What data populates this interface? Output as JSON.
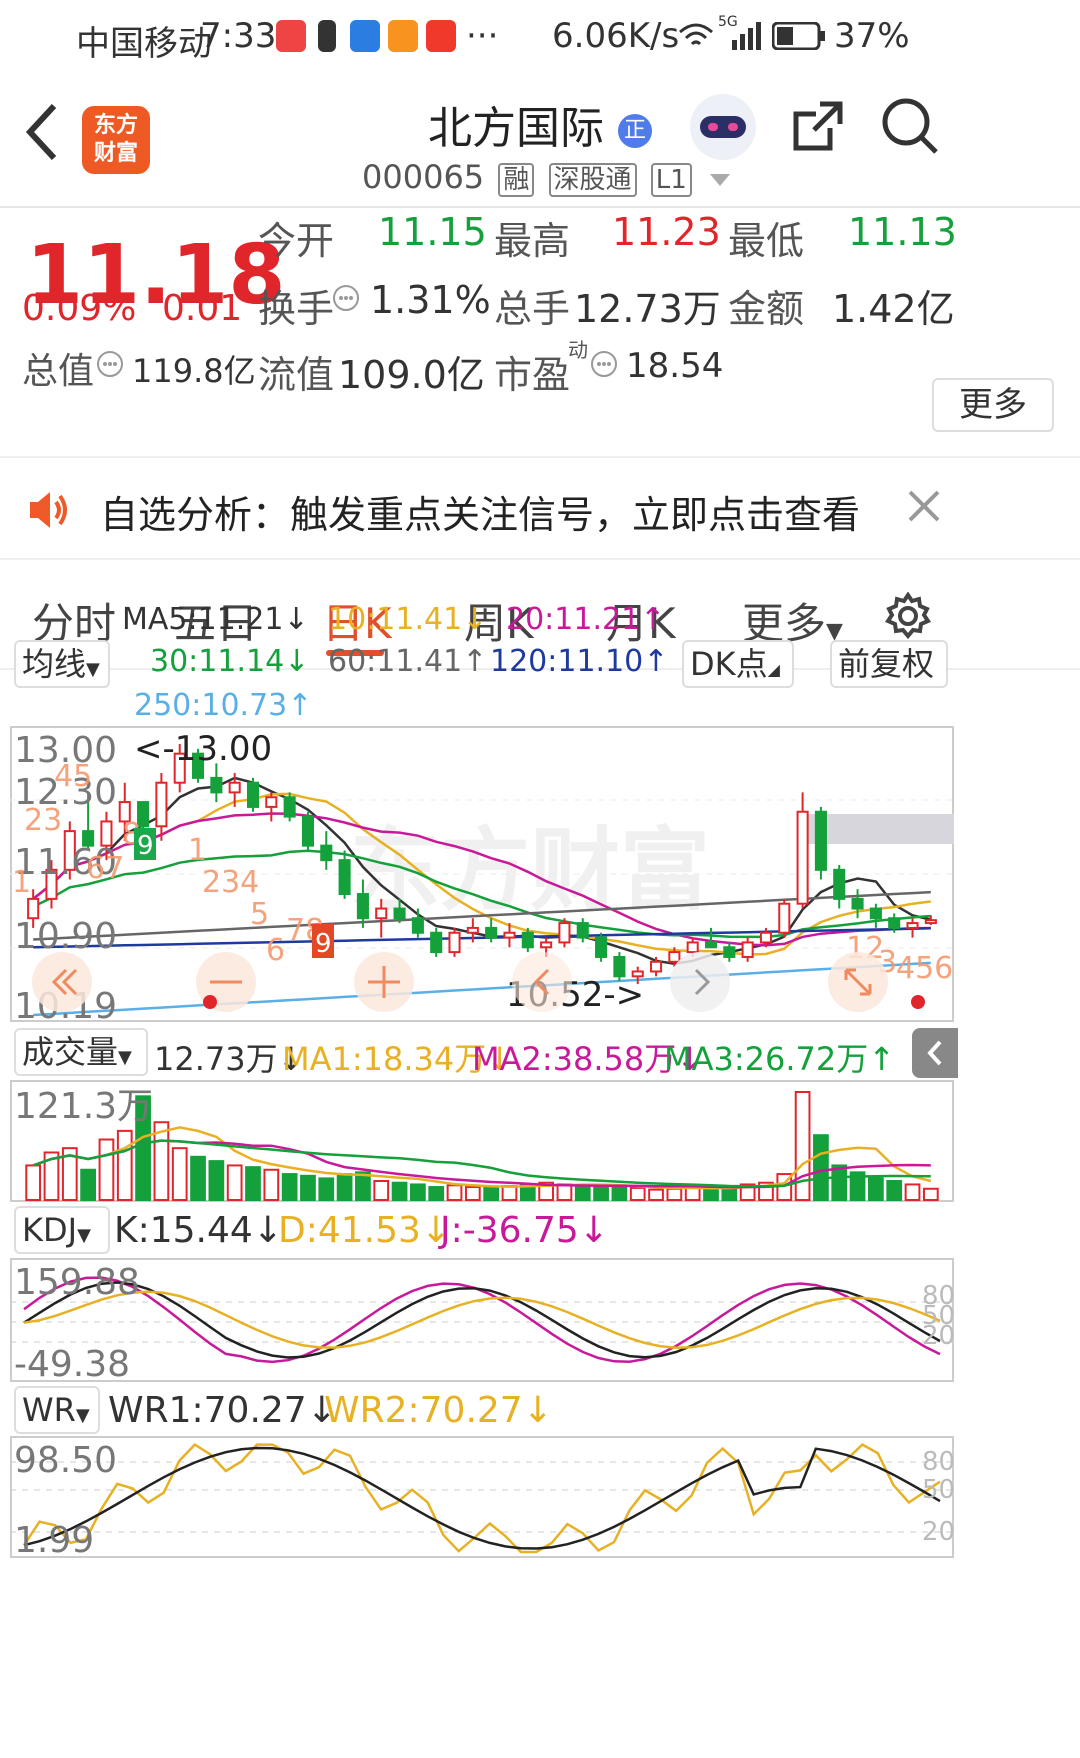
{
  "status": {
    "carrier": "中国移动",
    "time": "7:33",
    "speed": "6.06K/s",
    "battery": "37%",
    "more": "···",
    "net": "5G"
  },
  "header": {
    "logo_l1": "东方",
    "logo_l2": "财富",
    "title": "北方国际",
    "badge": "正",
    "code": "000065",
    "tags": [
      "融",
      "深股通",
      "L1"
    ]
  },
  "quote": {
    "price": "11.18",
    "pct": "0.09%",
    "chg": "0.01",
    "open_label": "今开",
    "open": "11.15",
    "high_label": "最高",
    "high": "11.23",
    "low_label": "最低",
    "low": "11.13",
    "turnover_label": "换手",
    "turnover": "1.31%",
    "vol_label": "总手",
    "vol": "12.73万",
    "amt_label": "金额",
    "amt": "1.42亿",
    "mcap_label": "总值",
    "mcap": "119.8亿",
    "float_label": "流值",
    "float": "109.0亿",
    "pe_label": "市盈",
    "pe_sup": "动",
    "pe": "18.54",
    "more": "更多"
  },
  "alert": {
    "text": "自选分析：触发重点关注信号，立即点击查看"
  },
  "tabs": [
    "分时",
    "五日",
    "日K",
    "周K",
    "月K",
    "更多"
  ],
  "ma": {
    "selector": "均线",
    "dk": "DK点",
    "adj": "前复权",
    "items": [
      {
        "text": "MA5:11.21↓",
        "color": "#333333"
      },
      {
        "text": "10:11.41↓",
        "color": "#e8b123"
      },
      {
        "text": "20:11.21↑",
        "color": "#c8199b"
      },
      {
        "text": "30:11.14↓",
        "color": "#14a03a"
      },
      {
        "text": "60:11.41↑",
        "color": "#666666"
      },
      {
        "text": "120:11.10↑",
        "color": "#1f3a9e"
      },
      {
        "text": "250:10.73↑",
        "color": "#5ab0e6"
      }
    ]
  },
  "kchart": {
    "y_ticks": [
      "13.00",
      "12.30",
      "11.60",
      "10.90",
      "10.19"
    ],
    "max_label": "<-13.00",
    "min_label": "10.52->",
    "counts": [
      "1",
      "23",
      "45",
      "67",
      "8",
      "9",
      "1",
      "234",
      "5",
      "6",
      "78",
      "9",
      "12",
      "3",
      "456"
    ],
    "watermark": "东方财富"
  },
  "chart_data": [
    {
      "type": "candlestick",
      "title": "日K",
      "ylim": [
        10.19,
        13.0
      ],
      "y_ticks": [
        13.0,
        12.3,
        11.6,
        10.9,
        10.19
      ],
      "candles": [
        [
          11.2,
          11.5,
          11.1,
          11.4
        ],
        [
          11.4,
          11.8,
          11.3,
          11.7
        ],
        [
          11.7,
          12.2,
          11.6,
          12.1
        ],
        [
          12.1,
          12.5,
          11.9,
          11.95
        ],
        [
          11.95,
          12.3,
          11.8,
          12.2
        ],
        [
          12.2,
          12.6,
          12.0,
          12.4
        ],
        [
          12.4,
          12.3,
          12.1,
          12.15
        ],
        [
          12.15,
          12.7,
          12.0,
          12.6
        ],
        [
          12.6,
          13.0,
          12.5,
          12.9
        ],
        [
          12.9,
          12.95,
          12.6,
          12.65
        ],
        [
          12.65,
          12.8,
          12.4,
          12.5
        ],
        [
          12.5,
          12.7,
          12.35,
          12.6
        ],
        [
          12.6,
          12.65,
          12.3,
          12.35
        ],
        [
          12.35,
          12.5,
          12.2,
          12.45
        ],
        [
          12.45,
          12.5,
          12.2,
          12.25
        ],
        [
          12.25,
          12.3,
          11.9,
          11.95
        ],
        [
          11.95,
          12.1,
          11.7,
          11.8
        ],
        [
          11.8,
          11.9,
          11.4,
          11.45
        ],
        [
          11.45,
          11.6,
          11.1,
          11.2
        ],
        [
          11.2,
          11.4,
          11.0,
          11.3
        ],
        [
          11.3,
          11.4,
          11.15,
          11.2
        ],
        [
          11.2,
          11.3,
          11.0,
          11.05
        ],
        [
          11.05,
          11.1,
          10.8,
          10.85
        ],
        [
          10.85,
          11.1,
          10.8,
          11.05
        ],
        [
          11.05,
          11.2,
          10.95,
          11.1
        ],
        [
          11.1,
          11.2,
          10.95,
          11.0
        ],
        [
          11.0,
          11.15,
          10.9,
          11.05
        ],
        [
          11.05,
          11.1,
          10.85,
          10.9
        ],
        [
          10.9,
          11.0,
          10.8,
          10.95
        ],
        [
          10.95,
          11.2,
          10.9,
          11.15
        ],
        [
          11.15,
          11.2,
          10.95,
          11.0
        ],
        [
          11.0,
          11.05,
          10.75,
          10.8
        ],
        [
          10.8,
          10.85,
          10.55,
          10.6
        ],
        [
          10.6,
          10.7,
          10.52,
          10.65
        ],
        [
          10.65,
          10.8,
          10.6,
          10.75
        ],
        [
          10.75,
          10.9,
          10.7,
          10.85
        ],
        [
          10.85,
          11.0,
          10.8,
          10.95
        ],
        [
          10.95,
          11.1,
          10.9,
          10.9
        ],
        [
          10.9,
          10.95,
          10.75,
          10.8
        ],
        [
          10.8,
          11.0,
          10.75,
          10.95
        ],
        [
          10.95,
          11.1,
          10.9,
          11.05
        ],
        [
          11.05,
          11.4,
          11.0,
          11.35
        ],
        [
          11.35,
          12.5,
          11.3,
          12.3
        ],
        [
          12.3,
          12.35,
          11.6,
          11.7
        ],
        [
          11.7,
          11.75,
          11.3,
          11.4
        ],
        [
          11.4,
          11.5,
          11.2,
          11.3
        ],
        [
          11.3,
          11.35,
          11.1,
          11.2
        ],
        [
          11.2,
          11.25,
          11.05,
          11.1
        ],
        [
          11.1,
          11.2,
          11.0,
          11.15
        ],
        [
          11.15,
          11.23,
          11.13,
          11.18
        ]
      ]
    },
    {
      "type": "bar",
      "title": "成交量",
      "ymax_label": "121.3万",
      "values": [
        40,
        55,
        60,
        35,
        70,
        80,
        120,
        90,
        60,
        50,
        45,
        40,
        38,
        35,
        30,
        28,
        25,
        30,
        32,
        22,
        20,
        18,
        15,
        17,
        15,
        14,
        16,
        18,
        20,
        18,
        17,
        16,
        15,
        14,
        12,
        13,
        15,
        14,
        15,
        18,
        20,
        30,
        125,
        75,
        40,
        32,
        25,
        22,
        18,
        13
      ]
    },
    {
      "type": "line",
      "title": "KDJ",
      "series_labels": [
        "K:15.44↓",
        "D:41.53↓",
        "J:-36.75↓"
      ],
      "ylim": [
        -49.38,
        159.88
      ],
      "ref_labels": [
        "80",
        "50",
        "20"
      ]
    },
    {
      "type": "line",
      "title": "WR",
      "series_labels": [
        "WR1:70.27↓",
        "WR2:70.27↓"
      ],
      "ylim": [
        1.99,
        98.5
      ],
      "ref_labels": [
        "80",
        "50",
        "20"
      ]
    }
  ],
  "volume": {
    "selector": "成交量",
    "now": "12.73万↓",
    "ma1": "MA1:18.34万↓",
    "ma2": "MA2:38.58万↓",
    "ma3": "MA3:26.72万↑",
    "ymax": "121.3万"
  },
  "kdj": {
    "selector": "KDJ",
    "k": "K:15.44↓",
    "d": "D:41.53↓",
    "j": "J:-36.75↓",
    "ymax": "159.88",
    "ymin": "-49.38"
  },
  "wr": {
    "selector": "WR",
    "wr1": "WR1:70.27↓",
    "wr2": "WR2:70.27↓",
    "ymax": "98.50",
    "ymin": "1.99"
  },
  "refs": [
    "80",
    "50",
    "20"
  ]
}
